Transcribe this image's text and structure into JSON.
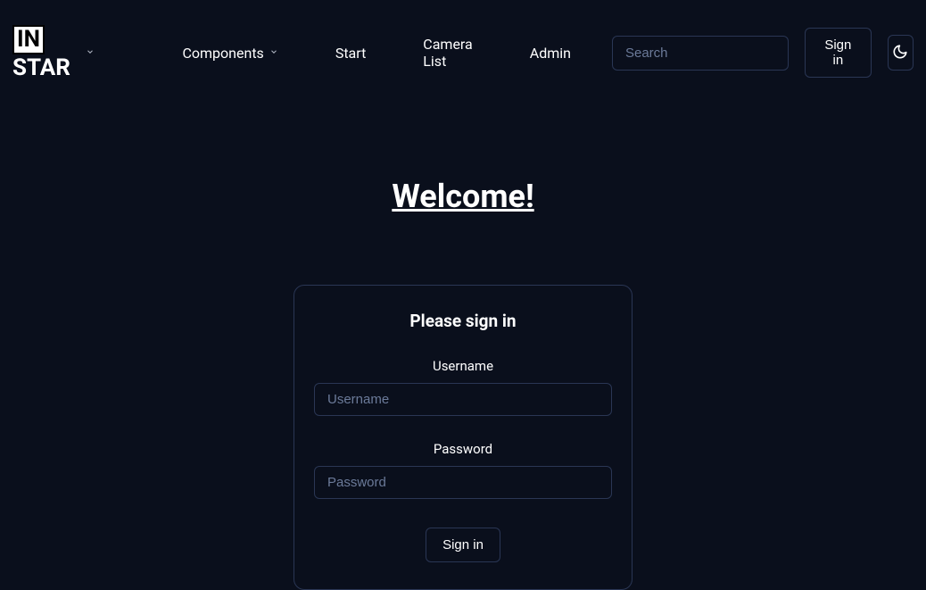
{
  "logo": {
    "boxed": "IN",
    "rest": "STAR"
  },
  "nav": {
    "components": "Components",
    "start": "Start",
    "camera_list": "Camera List",
    "admin": "Admin"
  },
  "header": {
    "search_placeholder": "Search",
    "signin_label": "Sign in"
  },
  "main": {
    "welcome": "Welcome!",
    "signin_card": {
      "title": "Please sign in",
      "username_label": "Username",
      "username_placeholder": "Username",
      "password_label": "Password",
      "password_placeholder": "Password",
      "submit_label": "Sign in"
    }
  }
}
